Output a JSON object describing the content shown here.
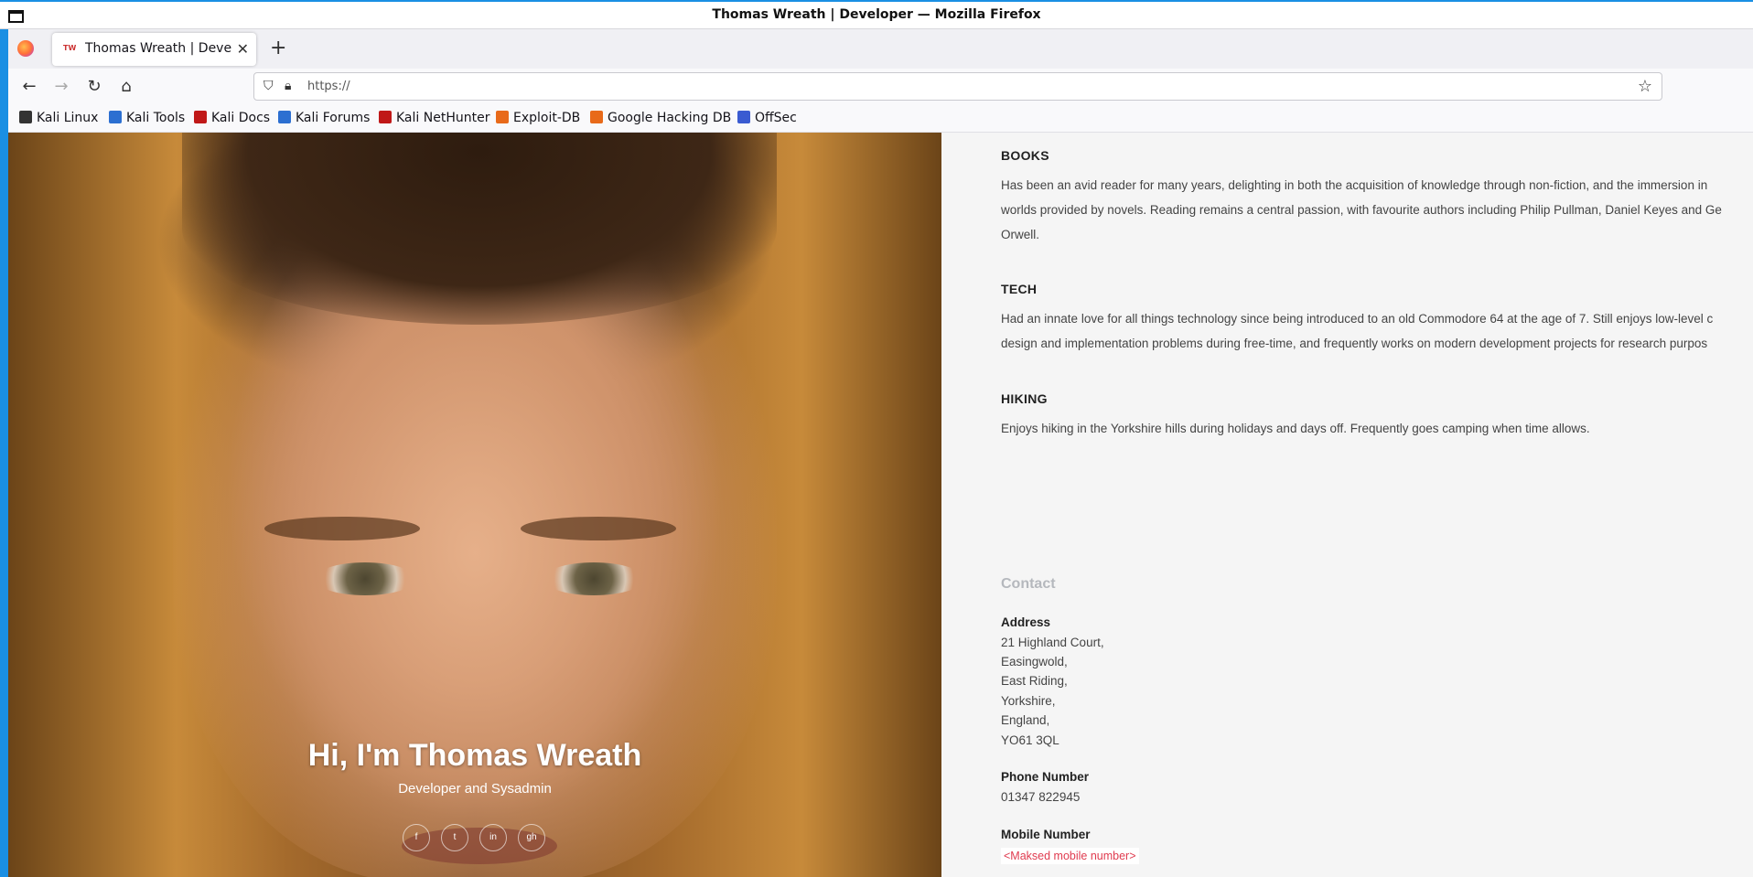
{
  "window": {
    "title": "Thomas Wreath | Developer — Mozilla Firefox"
  },
  "tab": {
    "label": "Thomas Wreath | Developer",
    "favicon_text": "TW"
  },
  "urlbar": {
    "url": "https://"
  },
  "bookmarks": [
    {
      "label": "Kali Linux",
      "color": "#333333"
    },
    {
      "label": "Kali Tools",
      "color": "#2c6fd1"
    },
    {
      "label": "Kali Docs",
      "color": "#c01818"
    },
    {
      "label": "Kali Forums",
      "color": "#2c6fd1"
    },
    {
      "label": "Kali NetHunter",
      "color": "#c01818"
    },
    {
      "label": "Exploit-DB",
      "color": "#e86a1a"
    },
    {
      "label": "Google Hacking DB",
      "color": "#e86a1a"
    },
    {
      "label": "OffSec",
      "color": "#3a5bd1"
    }
  ],
  "hero": {
    "name": "Hi, I'm Thomas Wreath",
    "role": "Developer and Sysadmin",
    "socials": [
      "f",
      "t",
      "in",
      "gh"
    ]
  },
  "sections": {
    "books": {
      "heading": "BOOKS",
      "lines": [
        "Has been an avid reader for many years, delighting in both the acquisition of knowledge through non-fiction, and the immersion in",
        "worlds provided by novels. Reading remains a central passion, with favourite authors including Philip Pullman, Daniel Keyes and Ge",
        "Orwell."
      ]
    },
    "tech": {
      "heading": "TECH",
      "lines": [
        "Had an innate love for all things technology since being introduced to an old Commodore 64 at the age of 7. Still enjoys low-level c",
        "design and implementation problems during free-time, and frequently works on modern development projects for research purpos"
      ]
    },
    "hiking": {
      "heading": "HIKING",
      "lines": [
        "Enjoys hiking in the Yorkshire hills during holidays and days off. Frequently goes camping when time allows."
      ]
    }
  },
  "contact": {
    "heading": "Contact",
    "address_label": "Address",
    "address_lines": [
      "21 Highland Court,",
      "Easingwold,",
      "East Riding,",
      "Yorkshire,",
      "England,",
      "YO61 3QL"
    ],
    "phone_label": "Phone Number",
    "phone": "01347 822945",
    "mobile_label": "Mobile Number",
    "mobile": "<Maksed mobile number>"
  }
}
